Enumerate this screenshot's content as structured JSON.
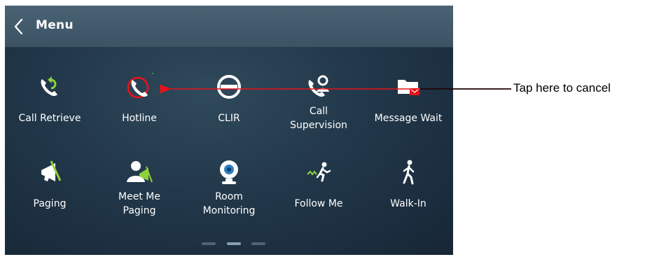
{
  "header": {
    "title": "Menu",
    "back_icon": "chevron-left-icon"
  },
  "tiles": [
    {
      "id": "call-retrieve",
      "label": "Call Retrieve",
      "icon": "call-retrieve-icon"
    },
    {
      "id": "hotline",
      "label": "Hotline",
      "icon": "hotline-icon",
      "status": "active"
    },
    {
      "id": "clir",
      "label": "CLIR",
      "icon": "clir-icon"
    },
    {
      "id": "call-supervision",
      "label": "Call\nSupervision",
      "icon": "call-supervision-icon"
    },
    {
      "id": "message-wait",
      "label": "Message Wait",
      "icon": "message-wait-icon"
    },
    {
      "id": "paging",
      "label": "Paging",
      "icon": "paging-megaphone-icon"
    },
    {
      "id": "meet-me-paging",
      "label": "Meet Me\nPaging",
      "icon": "meet-me-paging-icon"
    },
    {
      "id": "room-monitoring",
      "label": "Room\nMonitoring",
      "icon": "webcam-icon"
    },
    {
      "id": "follow-me",
      "label": "Follow Me",
      "icon": "follow-me-icon"
    },
    {
      "id": "walk-in",
      "label": "Walk-In",
      "icon": "walking-person-icon"
    }
  ],
  "pager": {
    "pages": 3,
    "current": 2
  },
  "annotation": {
    "callout_text": "Tap here to cancel",
    "arrow_color": "#e8121a"
  },
  "colors": {
    "background": "#22384a",
    "header": "#4a6374",
    "icon": "#ffffff",
    "accent_green": "#8ed23a",
    "alert_red": "#e8121a"
  }
}
